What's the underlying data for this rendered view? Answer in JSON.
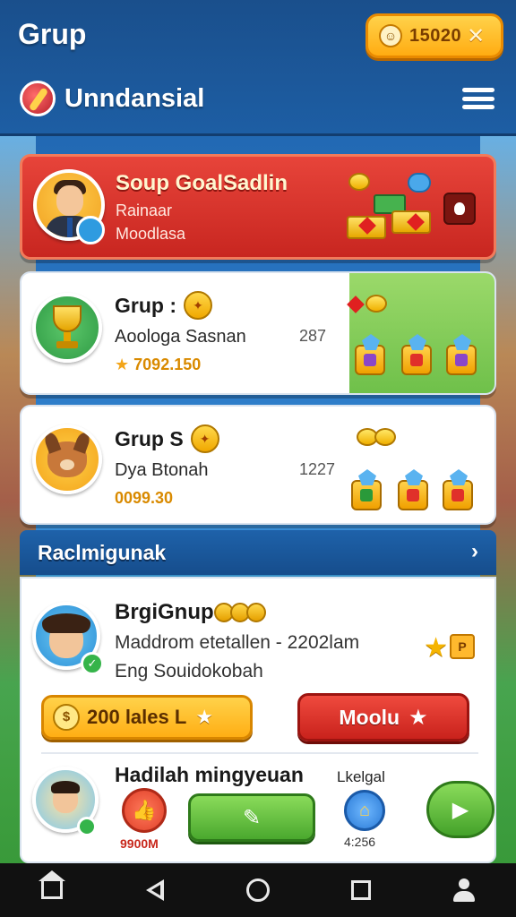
{
  "header": {
    "title": "Grup",
    "coins_value": "15020",
    "coins_close": "✕",
    "brand_name": "Unndansial"
  },
  "featured": {
    "title": "Soup GoalSadlin",
    "line1": "Rainaar",
    "line2": "Moodlasa"
  },
  "groups": [
    {
      "title": "Grup :",
      "desc": "Aoologa Sasnan",
      "count": "287",
      "amount": "7092.150"
    },
    {
      "title": "Grup S",
      "desc": "Dya Btonah",
      "count": "1227",
      "amount": "0099.30"
    }
  ],
  "recommend": {
    "title": "Raclmigunak",
    "chevron": "›"
  },
  "recommended_card": {
    "title": "BrgiGnup",
    "desc": "Maddrom etetallen - 2202lam",
    "desc2": "Eng Souidokobah",
    "tag": "P",
    "btn_yellow_label": "200 lales L",
    "btn_red_label": "Moolu",
    "second_title": "Hadilah mingyeuan",
    "thumb_value": "9900M",
    "small_label": "Lkelgal",
    "house_value": "4:256"
  },
  "colors": {
    "header": "#1d5ea4",
    "featured": "#d4302a",
    "gold": "#ffb020",
    "green": "#4aa82e"
  }
}
